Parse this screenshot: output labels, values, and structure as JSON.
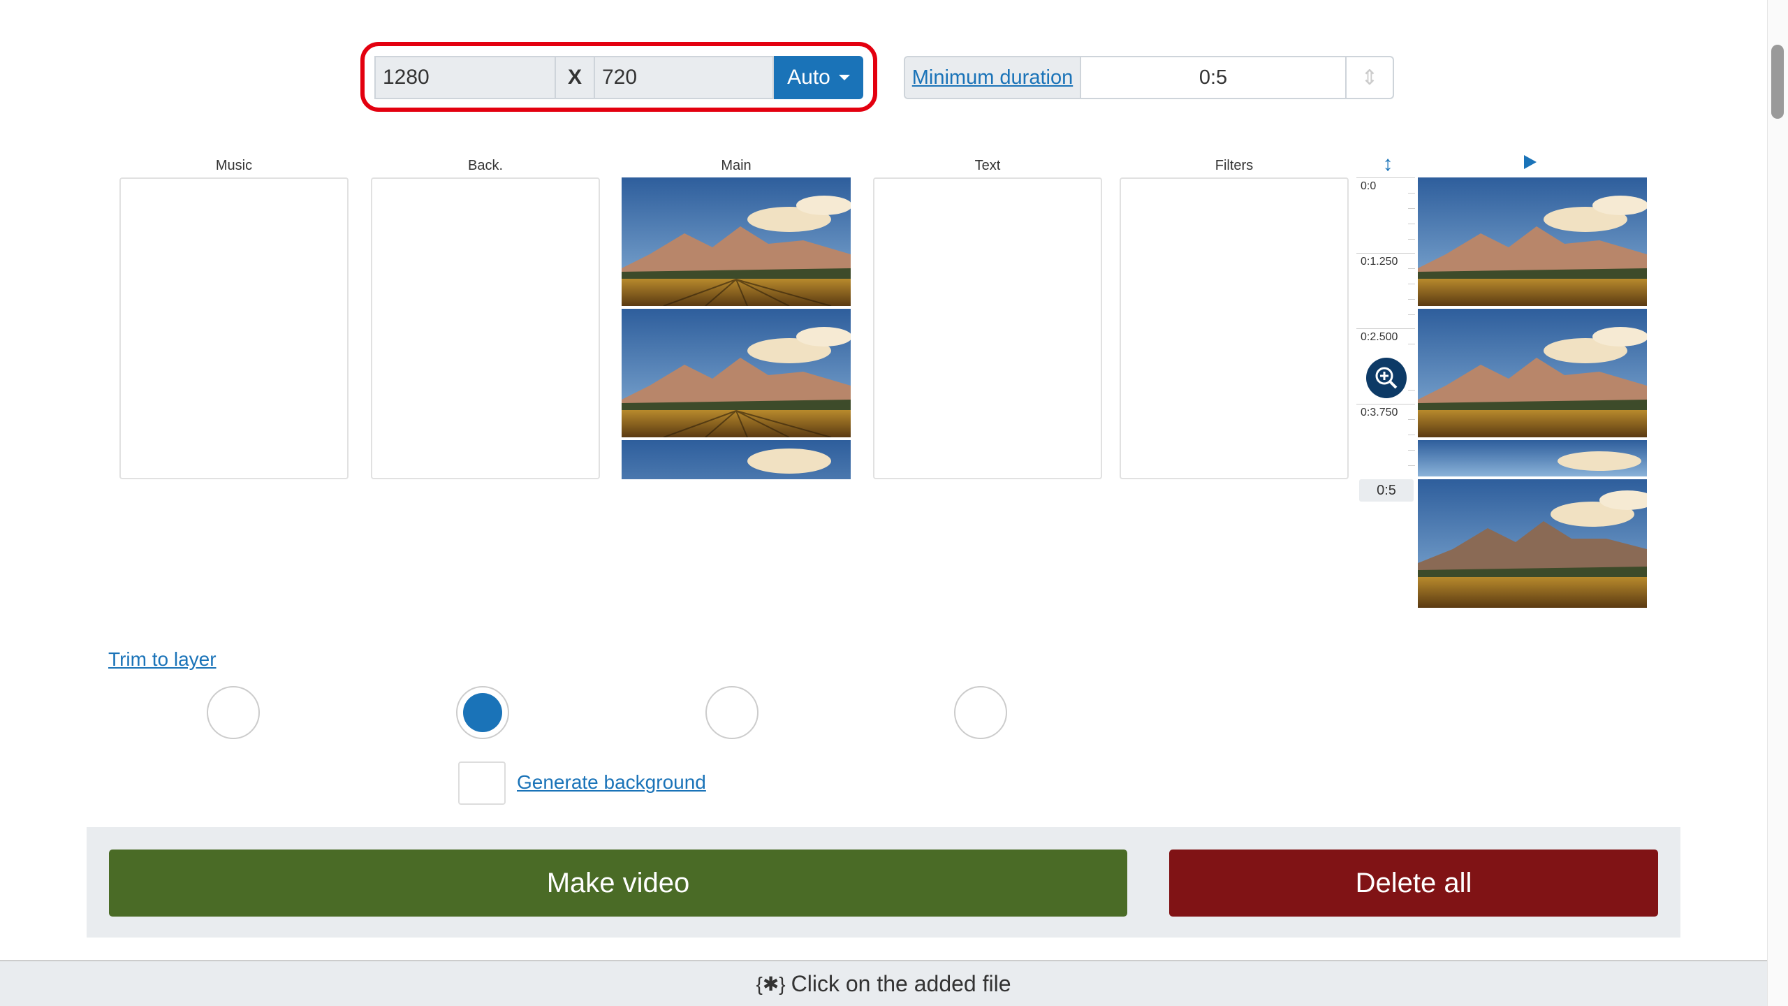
{
  "size": {
    "width": "1280",
    "separator": "X",
    "height": "720",
    "auto_label": "Auto"
  },
  "duration": {
    "label": "Minimum duration",
    "value": "0:5"
  },
  "columns": [
    {
      "id": "music",
      "label": "Music"
    },
    {
      "id": "back",
      "label": "Back."
    },
    {
      "id": "main",
      "label": "Main"
    },
    {
      "id": "text",
      "label": "Text"
    },
    {
      "id": "filters",
      "label": "Filters"
    }
  ],
  "ruler": {
    "marks": [
      "0:0",
      "0:1.250",
      "0:2.500",
      "0:3.750"
    ],
    "end": "0:5"
  },
  "trim_link": "Trim to layer",
  "radios": {
    "selected_index": 1
  },
  "generate_background": "Generate background",
  "buttons": {
    "make_video": "Make video",
    "delete_all": "Delete all"
  },
  "status": "Click on the added file",
  "colors": {
    "accent": "#1a73b8",
    "make": "#4a6b26",
    "delete": "#801315",
    "highlight": "#e3000f"
  }
}
